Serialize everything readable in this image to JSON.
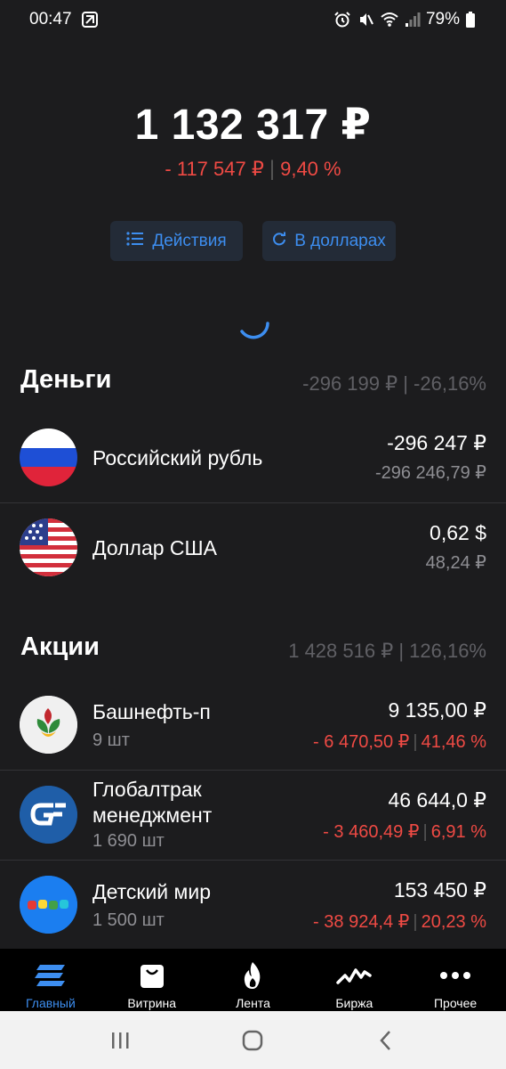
{
  "status_bar": {
    "time": "00:47",
    "battery": "79%"
  },
  "portfolio": {
    "total": "1 132 317 ₽",
    "change_abs": "- 117 547 ₽",
    "change_pct": "9,40 %",
    "change_color": "#ef4a44"
  },
  "actions": {
    "actions_label": "Действия",
    "dollars_label": "В долларах"
  },
  "money": {
    "title": "Деньги",
    "summary": "-296 199 ₽ | -26,16%",
    "items": [
      {
        "name": "Российский рубль",
        "value": "-296 247 ₽",
        "sub": "-296 246,79 ₽",
        "icon": "russia-flag-icon"
      },
      {
        "name": "Доллар США",
        "value": "0,62 $",
        "sub": "48,24 ₽",
        "icon": "usa-flag-icon"
      }
    ]
  },
  "stocks": {
    "title": "Акции",
    "summary": "1 428 516 ₽ | 126,16%",
    "items": [
      {
        "name": "Башнефть-п",
        "qty": "9 шт",
        "value": "9 135,00 ₽",
        "change_abs": "- 6 470,50 ₽",
        "change_pct": "41,46 %",
        "icon": "bashneft-logo-icon"
      },
      {
        "name_line1": "Глобалтрак",
        "name_line2": "менеджмент",
        "qty": "1 690 шт",
        "value": "46 644,0 ₽",
        "change_abs": "- 3 460,49 ₽",
        "change_pct": "6,91 %",
        "icon": "globaltrans-logo-icon"
      },
      {
        "name": "Детский мир",
        "qty": "1 500 шт",
        "value": "153 450 ₽",
        "change_abs": "- 38 924,4 ₽",
        "change_pct": "20,23 %",
        "icon": "detsky-mir-logo-icon"
      }
    ]
  },
  "tabs": [
    {
      "label": "Главный",
      "icon": "home-stack-icon",
      "active": true
    },
    {
      "label": "Витрина",
      "icon": "shopping-bag-icon",
      "active": false
    },
    {
      "label": "Лента",
      "icon": "flame-icon",
      "active": false
    },
    {
      "label": "Биржа",
      "icon": "chart-line-icon",
      "active": false
    },
    {
      "label": "Прочее",
      "icon": "more-dots-icon",
      "active": false
    }
  ],
  "colors": {
    "background": "#1c1c1e",
    "accent": "#3d8ef0",
    "negative": "#ef4a44",
    "muted": "#8e8e93"
  }
}
